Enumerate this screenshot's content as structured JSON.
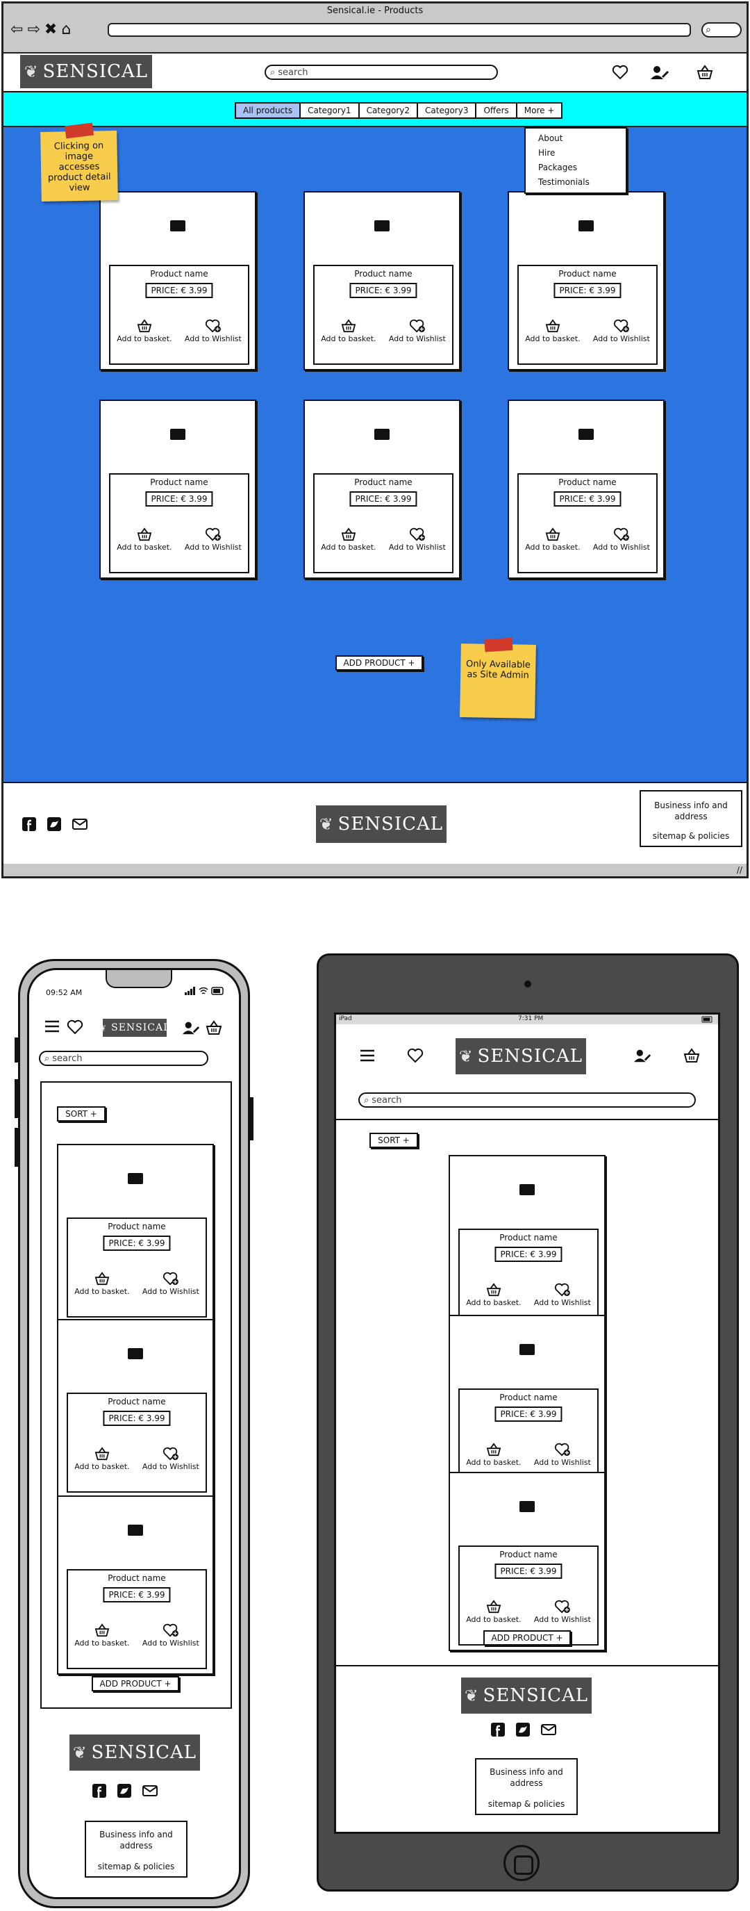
{
  "browser": {
    "title": "Sensical.ie - Products",
    "nav_glyphs": [
      "⇦",
      "⇨",
      "✖",
      "⌂"
    ]
  },
  "brand": {
    "logo_text": "SENSICAL",
    "leaf": "❦"
  },
  "search": {
    "placeholder": "search"
  },
  "desktop": {
    "tabs": [
      "All products",
      "Category1",
      "Category2",
      "Category3",
      "Offers",
      "More +"
    ],
    "active_tab": "All products",
    "more_menu": [
      "About",
      "Hire",
      "Packages",
      "Testimonials"
    ],
    "note_detail": "Clicking on image accesses product detail view",
    "note_admin": "Only Available as Site Admin"
  },
  "product": {
    "name": "Product name",
    "price": "PRICE: € 3.99",
    "basket_label": "Add to basket.",
    "wishlist_label": "Add to Wishlist"
  },
  "add_product_label": "ADD PRODUCT +",
  "sort_label": "SORT +",
  "footer": {
    "business_info": "Business info and address",
    "sitemap": "sitemap & policies"
  },
  "phone": {
    "time": "09:52 AM"
  },
  "tablet": {
    "carrier": "iPad",
    "time": "7:31 PM"
  },
  "colors": {
    "accent_blue": "#2c74e0",
    "cyan": "#00ffff",
    "sticky": "#f8cd4c",
    "logo_bg": "#4c4c4c",
    "tape": "#d13a2a"
  }
}
